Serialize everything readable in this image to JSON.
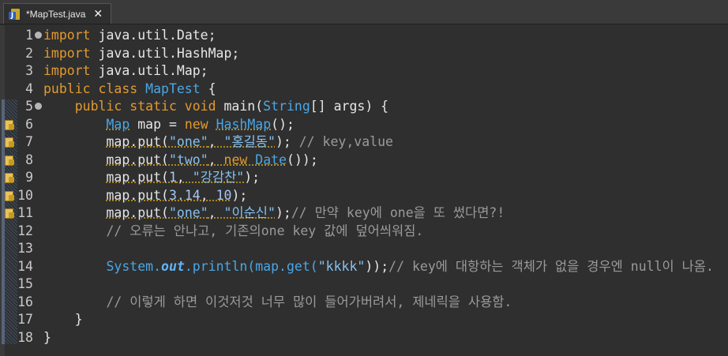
{
  "tab": {
    "title": "*MapTest.java",
    "icon": "java-file-icon",
    "close": "🗙"
  },
  "lines": [
    {
      "n": "1",
      "tokens": [
        {
          "t": "import",
          "c": "kw"
        },
        {
          "t": " java.util.Date;",
          "c": "id"
        }
      ],
      "fold": true
    },
    {
      "n": "2",
      "tokens": [
        {
          "t": "import",
          "c": "kw"
        },
        {
          "t": " java.util.HashMap;",
          "c": "id"
        }
      ]
    },
    {
      "n": "3",
      "tokens": [
        {
          "t": "import",
          "c": "kw"
        },
        {
          "t": " java.util.Map;",
          "c": "id"
        }
      ]
    },
    {
      "n": "4",
      "tokens": [
        {
          "t": "public class ",
          "c": "kw"
        },
        {
          "t": "MapTest",
          "c": "cls"
        },
        {
          "t": " {",
          "c": "id"
        }
      ]
    },
    {
      "n": "5",
      "tokens": [
        {
          "t": "    public static void ",
          "c": "kw"
        },
        {
          "t": "main",
          "c": "mth"
        },
        {
          "t": "(",
          "c": "id"
        },
        {
          "t": "String",
          "c": "cls"
        },
        {
          "t": "[] args) {",
          "c": "id"
        }
      ],
      "fold": true
    },
    {
      "n": "6",
      "warn": true,
      "tokens": [
        {
          "t": "        ",
          "c": "id"
        },
        {
          "t": "Map",
          "c": "cls",
          "u": true
        },
        {
          "t": " map = ",
          "c": "id"
        },
        {
          "t": "new ",
          "c": "kw"
        },
        {
          "t": "HashMap",
          "c": "cls",
          "u": true
        },
        {
          "t": "();",
          "c": "id"
        }
      ]
    },
    {
      "n": "7",
      "warn": true,
      "tokens": [
        {
          "t": "        ",
          "c": "id"
        },
        {
          "t": "map.put(",
          "c": "id",
          "u": true
        },
        {
          "t": "\"one\"",
          "c": "str",
          "u": true
        },
        {
          "t": ", ",
          "c": "id",
          "u": true
        },
        {
          "t": "\"홍길동\"",
          "c": "str",
          "u": true
        },
        {
          "t": "); ",
          "c": "id"
        },
        {
          "t": "// key,value",
          "c": "cmt"
        }
      ]
    },
    {
      "n": "8",
      "warn": true,
      "tokens": [
        {
          "t": "        ",
          "c": "id"
        },
        {
          "t": "map.put(",
          "c": "id",
          "u": true
        },
        {
          "t": "\"two\"",
          "c": "str",
          "u": true
        },
        {
          "t": ", ",
          "c": "id",
          "u": true
        },
        {
          "t": "new ",
          "c": "kw",
          "u": true
        },
        {
          "t": "Date",
          "c": "cls",
          "u": true
        },
        {
          "t": "());",
          "c": "id"
        }
      ]
    },
    {
      "n": "9",
      "warn": true,
      "tokens": [
        {
          "t": "        ",
          "c": "id"
        },
        {
          "t": "map.put(",
          "c": "id",
          "u": true
        },
        {
          "t": "1",
          "c": "num",
          "u": true
        },
        {
          "t": ", ",
          "c": "id",
          "u": true
        },
        {
          "t": "\"강감찬\"",
          "c": "str",
          "u": true
        },
        {
          "t": ");",
          "c": "id"
        }
      ]
    },
    {
      "n": "10",
      "warn": true,
      "tokens": [
        {
          "t": "        ",
          "c": "id"
        },
        {
          "t": "map.put(",
          "c": "id",
          "u": true
        },
        {
          "t": "3.14",
          "c": "num",
          "u": true
        },
        {
          "t": ", ",
          "c": "id",
          "u": true
        },
        {
          "t": "10",
          "c": "num",
          "u": true
        },
        {
          "t": ");",
          "c": "id"
        }
      ]
    },
    {
      "n": "11",
      "warn": true,
      "tokens": [
        {
          "t": "        ",
          "c": "id"
        },
        {
          "t": "map.put(",
          "c": "id",
          "u": true
        },
        {
          "t": "\"one\"",
          "c": "str",
          "u": true
        },
        {
          "t": ", ",
          "c": "id",
          "u": true
        },
        {
          "t": "\"이순신\"",
          "c": "str",
          "u": true
        },
        {
          "t": ");",
          "c": "id"
        },
        {
          "t": "// 만약 key에 one을 또 썼다면?!",
          "c": "cmt"
        }
      ]
    },
    {
      "n": "12",
      "tokens": [
        {
          "t": "        ",
          "c": "id"
        },
        {
          "t": "// 오류는 안나고, 기존의one key 값에 덮어씌워짐.",
          "c": "cmt"
        }
      ]
    },
    {
      "n": "13",
      "tokens": []
    },
    {
      "n": "14",
      "tokens": [
        {
          "t": "        ",
          "c": "id"
        },
        {
          "t": "System.",
          "c": "cls"
        },
        {
          "t": "out",
          "c": "stat"
        },
        {
          "t": ".println(map.get(",
          "c": "cls"
        },
        {
          "t": "\"kkkk\"",
          "c": "str"
        },
        {
          "t": "));",
          "c": "id"
        },
        {
          "t": "// key에 대항하는 객체가 없을 경우엔 null이 나옴.",
          "c": "cmt"
        }
      ]
    },
    {
      "n": "15",
      "tokens": []
    },
    {
      "n": "16",
      "tokens": [
        {
          "t": "        ",
          "c": "id"
        },
        {
          "t": "// 이렇게 하면 이것저것 너무 많이 들어가버려서, 제네릭을 사용함.",
          "c": "cmt"
        }
      ]
    },
    {
      "n": "17",
      "tokens": [
        {
          "t": "    }",
          "c": "id"
        }
      ]
    },
    {
      "n": "18",
      "tokens": [
        {
          "t": "}",
          "c": "id"
        }
      ]
    }
  ]
}
